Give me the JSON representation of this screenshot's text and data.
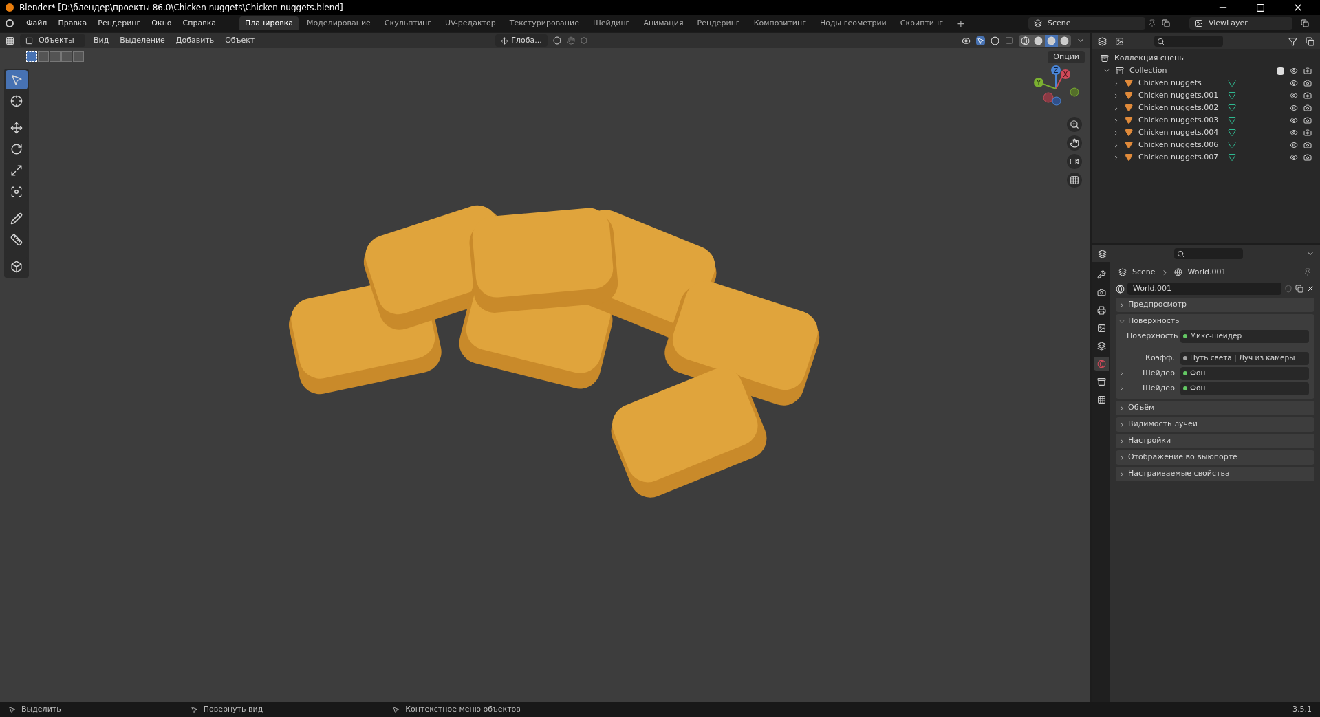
{
  "window": {
    "title": "Blender* [D:\\блендер\\проекты 86.0\\Chicken nuggets\\Chicken nuggets.blend]"
  },
  "menu": [
    "Файл",
    "Правка",
    "Рендеринг",
    "Окно",
    "Справка"
  ],
  "workspaces": [
    {
      "label": "Планировка",
      "selected": true
    },
    {
      "label": "Моделирование",
      "selected": false
    },
    {
      "label": "Скульптинг",
      "selected": false
    },
    {
      "label": "UV-редактор",
      "selected": false
    },
    {
      "label": "Текстурирование",
      "selected": false
    },
    {
      "label": "Шейдинг",
      "selected": false
    },
    {
      "label": "Анимация",
      "selected": false
    },
    {
      "label": "Рендеринг",
      "selected": false
    },
    {
      "label": "Композитинг",
      "selected": false
    },
    {
      "label": "Ноды геометрии",
      "selected": false
    },
    {
      "label": "Скриптинг",
      "selected": false
    }
  ],
  "add_workspace": "+",
  "scene": {
    "scene_name": "Scene",
    "view_layer": "ViewLayer"
  },
  "viewport": {
    "mode": "Объекты",
    "menus": [
      "Вид",
      "Выделение",
      "Добавить",
      "Объект"
    ],
    "orientation": "Глоба...",
    "options": "Опции",
    "shading": [
      {
        "kind": "wire",
        "selected": false
      },
      {
        "kind": "solid",
        "selected": false
      },
      {
        "kind": "material",
        "selected": true
      },
      {
        "kind": "rendered",
        "selected": false
      }
    ],
    "select_modes": [
      {
        "selected": true
      },
      {
        "selected": false
      },
      {
        "selected": false
      },
      {
        "selected": false
      },
      {
        "selected": false
      }
    ],
    "tools": [
      {
        "kind": "select",
        "selected": true
      },
      {
        "kind": "cursor",
        "selected": false
      },
      {
        "kind": "move",
        "selected": false
      },
      {
        "kind": "rotate",
        "selected": false
      },
      {
        "kind": "scale",
        "selected": false
      },
      {
        "kind": "transform",
        "selected": false
      },
      {
        "kind": "annotate",
        "selected": false
      },
      {
        "kind": "measure",
        "selected": false
      },
      {
        "kind": "add",
        "selected": false
      }
    ],
    "gizmo": {
      "x": "X",
      "y": "Y",
      "z": "Z"
    }
  },
  "outliner": {
    "root": "Коллекция сцены",
    "collection": {
      "name": "Collection",
      "checked": true,
      "expanded": true,
      "children": [
        {
          "name": "Chicken nuggets"
        },
        {
          "name": "Chicken nuggets.001"
        },
        {
          "name": "Chicken nuggets.002"
        },
        {
          "name": "Chicken nuggets.003"
        },
        {
          "name": "Chicken nuggets.004"
        },
        {
          "name": "Chicken nuggets.006"
        },
        {
          "name": "Chicken nuggets.007"
        }
      ]
    }
  },
  "properties": {
    "tabs": [
      {
        "kind": "tool",
        "selected": false
      },
      {
        "kind": "render",
        "selected": false
      },
      {
        "kind": "output",
        "selected": false
      },
      {
        "kind": "view_layer",
        "selected": false
      },
      {
        "kind": "scene",
        "selected": false
      },
      {
        "kind": "world",
        "selected": true
      },
      {
        "kind": "collection",
        "selected": false
      },
      {
        "kind": "texture",
        "selected": false
      }
    ],
    "breadcrumb": [
      "Scene",
      "World.001"
    ],
    "world_name": "World.001",
    "panels": [
      {
        "title": "Предпросмотр",
        "expanded": false
      },
      {
        "title": "Поверхность",
        "expanded": true,
        "rows": [
          {
            "label": "Поверхность",
            "value": "Микс-шейдер",
            "color": "#63c763",
            "expandable": false
          },
          {
            "label": "Коэфф.",
            "value": "Путь света | Луч из камеры",
            "color": "#a1a1a1",
            "expandable": false
          },
          {
            "label": "Шейдер",
            "value": "Фон",
            "color": "#63c763",
            "expandable": true
          },
          {
            "label": "Шейдер",
            "value": "Фон",
            "color": "#63c763",
            "expandable": true
          }
        ]
      },
      {
        "title": "Объём",
        "expanded": false
      },
      {
        "title": "Видимость лучей",
        "expanded": false
      },
      {
        "title": "Настройки",
        "expanded": false
      },
      {
        "title": "Отображение во выюпорте",
        "expanded": false
      },
      {
        "title": "Настраиваемые свойства",
        "expanded": false
      }
    ]
  },
  "status_bar": {
    "hints": [
      "Выделить",
      "Повернуть вид",
      "Контекстное меню объектов"
    ],
    "version": "3.5.1"
  }
}
